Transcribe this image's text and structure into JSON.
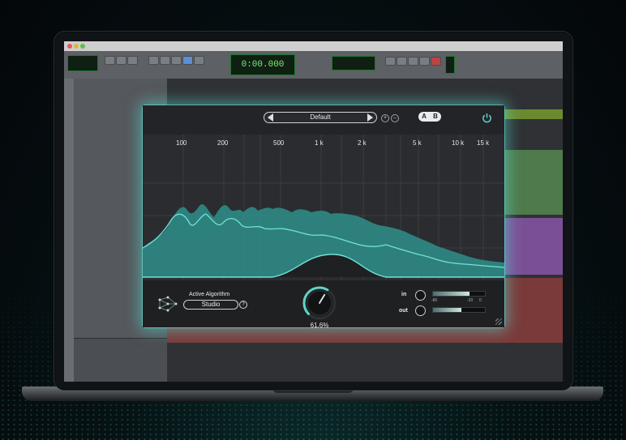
{
  "daw": {
    "counter": "0:00.000",
    "toolbar_colors": {
      "lcd": "#7cf07c",
      "accent": "#5a8fd6"
    }
  },
  "plugin": {
    "preset_name": "Default",
    "ab": {
      "a": "A",
      "b": "B"
    },
    "frequency_labels": [
      "100",
      "200",
      "500",
      "1 k",
      "2 k",
      "5 k",
      "10 k",
      "15 k"
    ],
    "algorithm": {
      "label": "Active Algorithm",
      "value": "Studio",
      "help": "?"
    },
    "amount": "61.6%",
    "amount_fraction": 0.616,
    "in_label": "in",
    "out_label": "out",
    "meter_scale": [
      "-80",
      "-20",
      "0"
    ],
    "colors": {
      "accent": "#5fd3c8",
      "spectrum_fill": "#2f8a86",
      "spectrum_line": "#6fe3d6"
    }
  }
}
